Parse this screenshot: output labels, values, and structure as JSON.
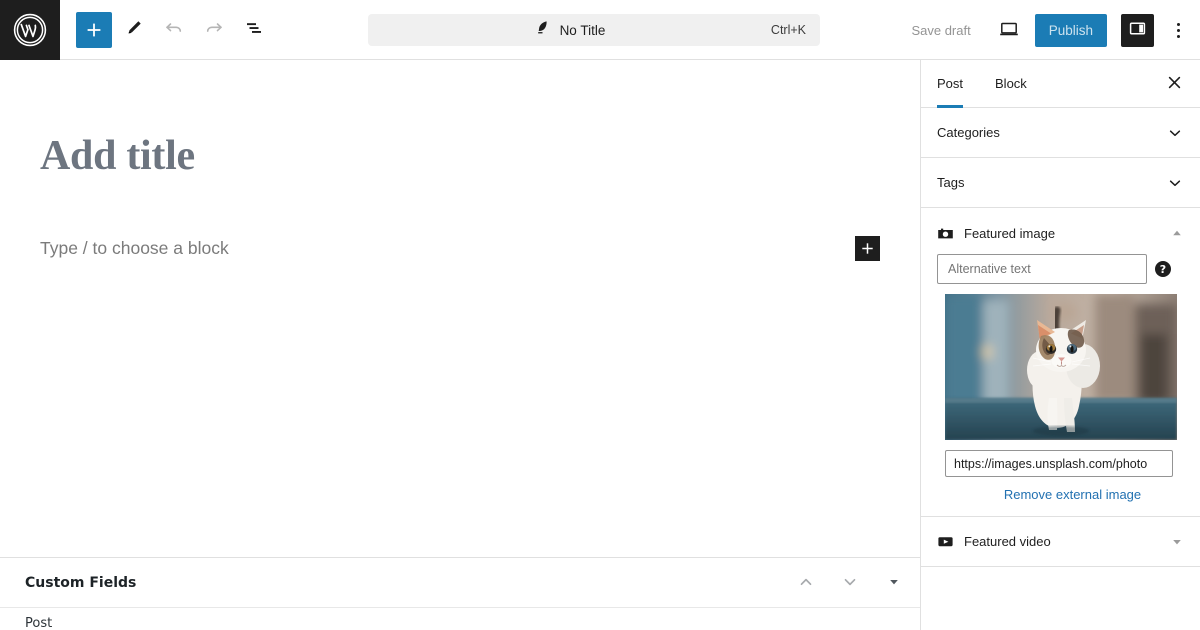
{
  "app": {
    "logo_alt": "wordpress-logo"
  },
  "toolbar": {
    "add_block_label": "+",
    "tools": [
      {
        "name": "block-inserter-toggle",
        "icon": "plus-icon"
      },
      {
        "name": "tools-edit",
        "icon": "pencil-icon"
      },
      {
        "name": "undo",
        "icon": "undo-icon"
      },
      {
        "name": "redo",
        "icon": "redo-icon"
      },
      {
        "name": "document-overview",
        "icon": "list-view-icon"
      }
    ]
  },
  "command_bar": {
    "icon": "quill-pen-icon",
    "title": "No Title",
    "shortcut": "Ctrl+K",
    "placeholder": "No Title"
  },
  "header_actions": {
    "save_draft_label": "Save draft",
    "preview_icon": "desktop-preview-icon",
    "publish_label": "Publish",
    "sidebar_toggle_icon": "settings-sidebar-icon",
    "options_icon": "kebab-menu-icon"
  },
  "editor": {
    "title_placeholder": "Add title",
    "block_placeholder": "Type / to choose a block",
    "inserter_label": "+"
  },
  "metabox": {
    "title": "Custom Fields",
    "move_up_icon": "chevron-up-icon",
    "move_down_icon": "chevron-down-icon",
    "toggle_icon": "triangle-down-icon",
    "body_text": "Post"
  },
  "sidebar": {
    "tabs": [
      {
        "label": "Post",
        "active": true
      },
      {
        "label": "Block",
        "active": false
      }
    ],
    "close_icon": "close-icon",
    "panels": [
      {
        "label": "Categories",
        "state": "collapsed",
        "icon": "chevron-down-icon"
      },
      {
        "label": "Tags",
        "state": "collapsed",
        "icon": "chevron-down-icon"
      },
      {
        "label": "Featured image",
        "state": "expanded",
        "icon": "camera-icon"
      },
      {
        "label": "Featured video",
        "state": "collapsed",
        "icon": "play-video-icon"
      }
    ],
    "featured_image": {
      "alt_placeholder": "Alternative text",
      "alt_value": "",
      "help_icon": "help-circle-icon",
      "thumbnail_alt": "white and calico cat walking on street",
      "url_value": "https://images.unsplash.com/photo",
      "remove_label": "Remove external image"
    }
  },
  "colors": {
    "accent": "#1b7cb5",
    "link": "#2271b1",
    "dark": "#1e1e1e",
    "muted": "#949494",
    "title_grey": "#6d7580"
  }
}
